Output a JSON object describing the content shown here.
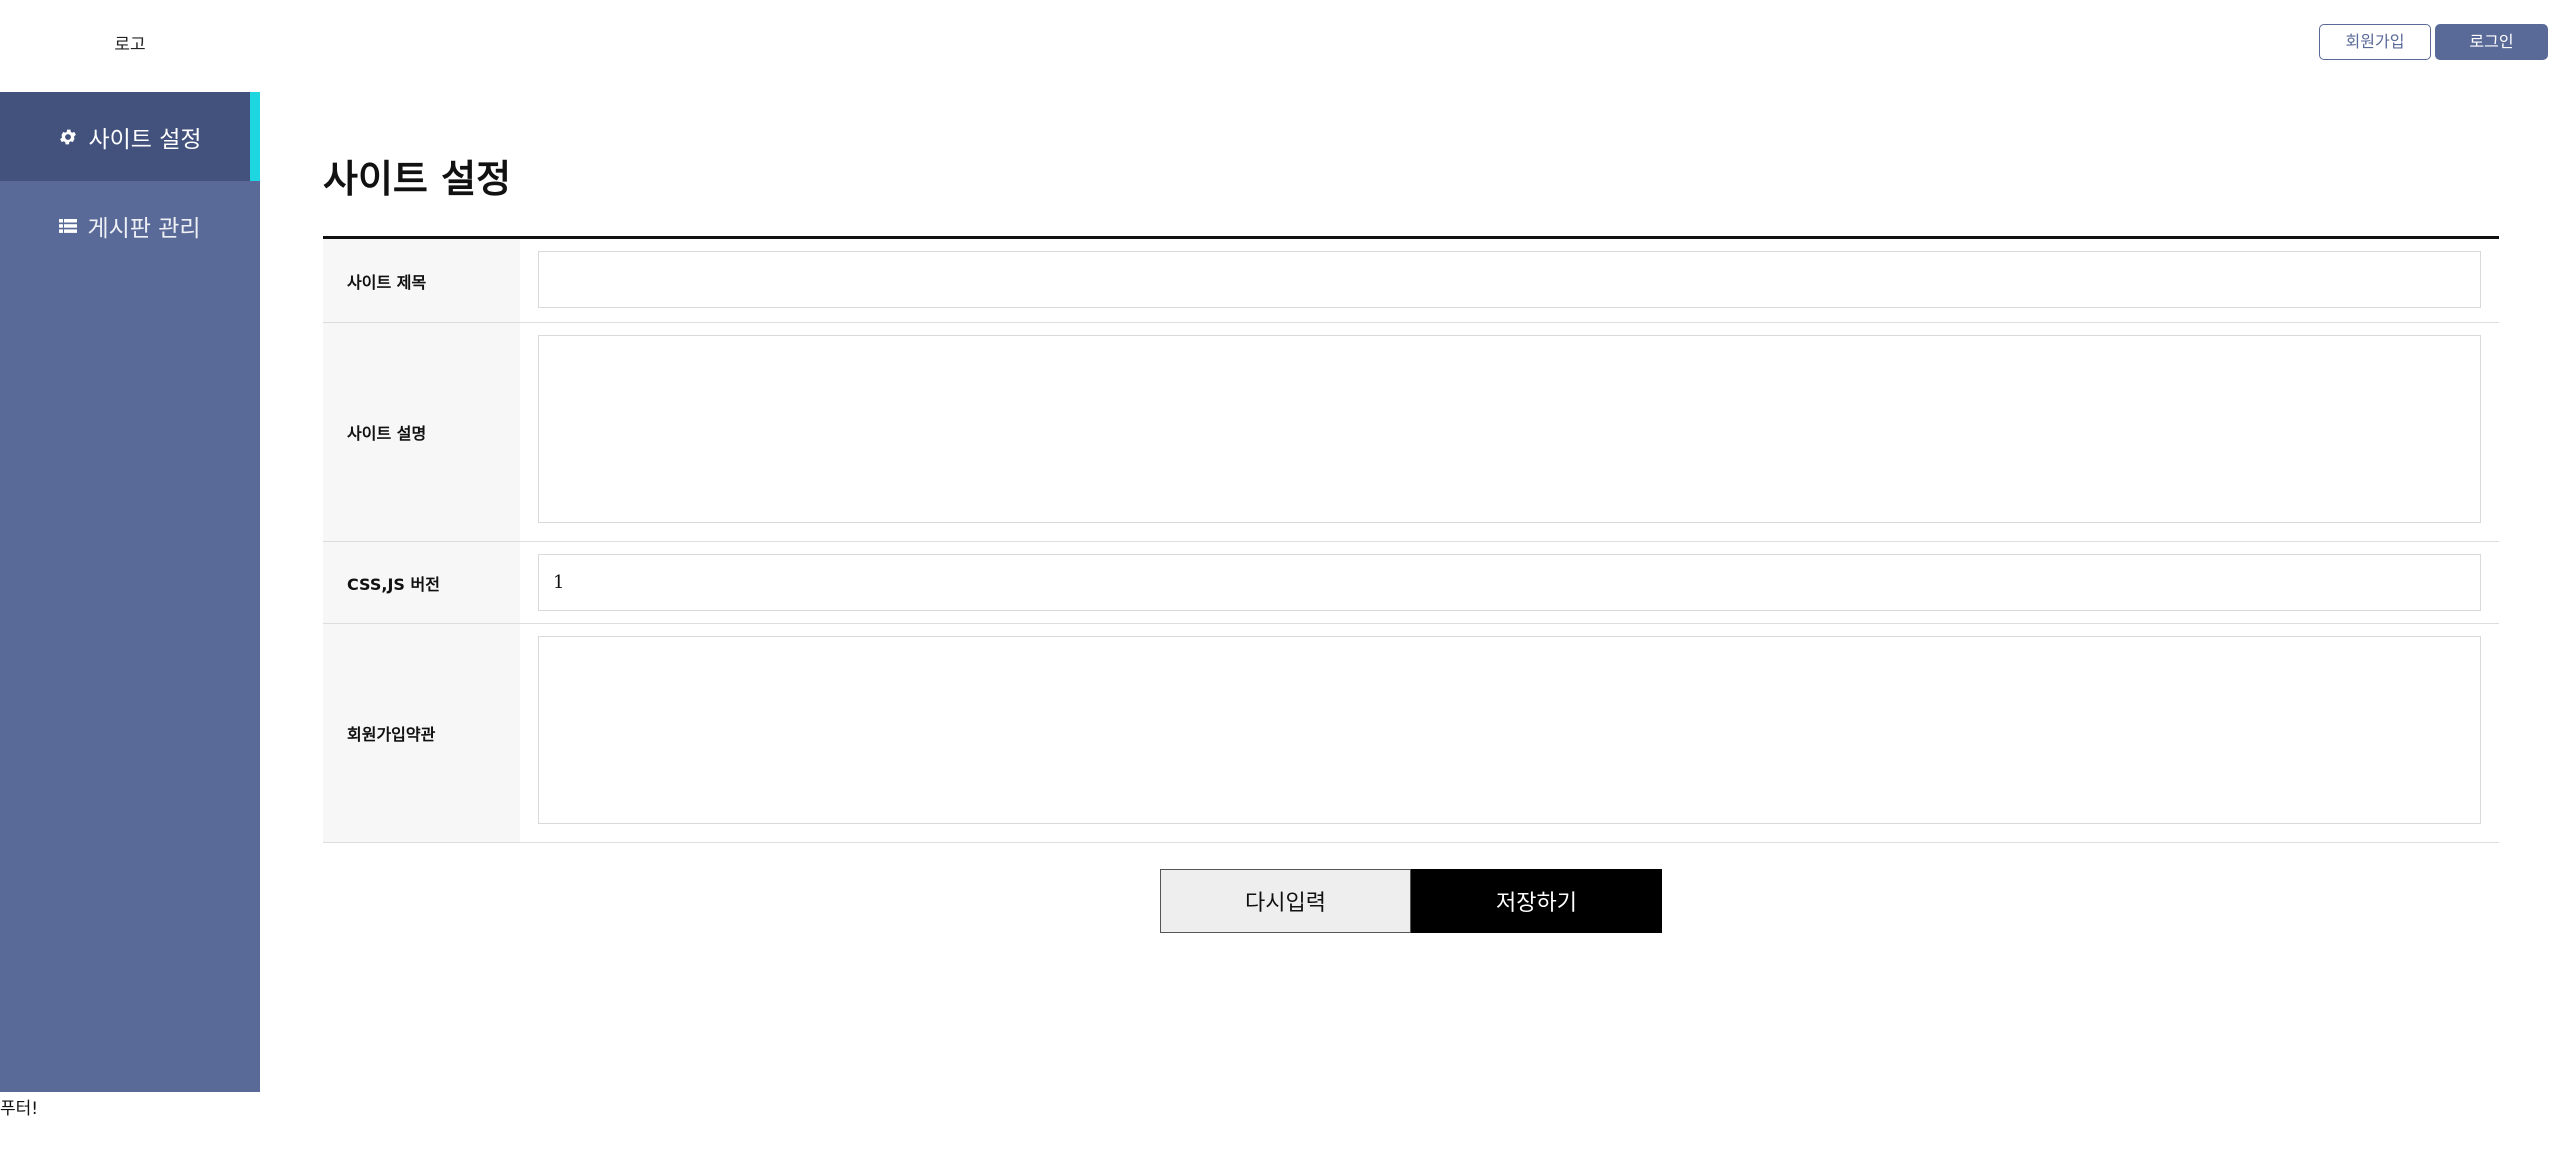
{
  "header": {
    "logo": "로고",
    "join_label": "회원가입",
    "login_label": "로그인"
  },
  "sidebar": {
    "items": [
      {
        "label": "사이트 설정",
        "icon": "gear-icon",
        "active": true
      },
      {
        "label": "게시판 관리",
        "icon": "list-icon",
        "active": false
      }
    ]
  },
  "main": {
    "title": "사이트 설정",
    "fields": [
      {
        "label": "사이트 제목",
        "value": ""
      },
      {
        "label": "사이트 설명",
        "value": ""
      },
      {
        "label": "CSS,JS 버전",
        "value": "1"
      },
      {
        "label": "회원가입약관",
        "value": ""
      }
    ],
    "reset_label": "다시입력",
    "save_label": "저장하기"
  },
  "footer": {
    "text": "푸터!"
  },
  "colors": {
    "sidebar_bg": "#5a6a98",
    "sidebar_active_bg": "#43527d",
    "accent": "#1ed6e0",
    "save_bg": "#000000"
  }
}
